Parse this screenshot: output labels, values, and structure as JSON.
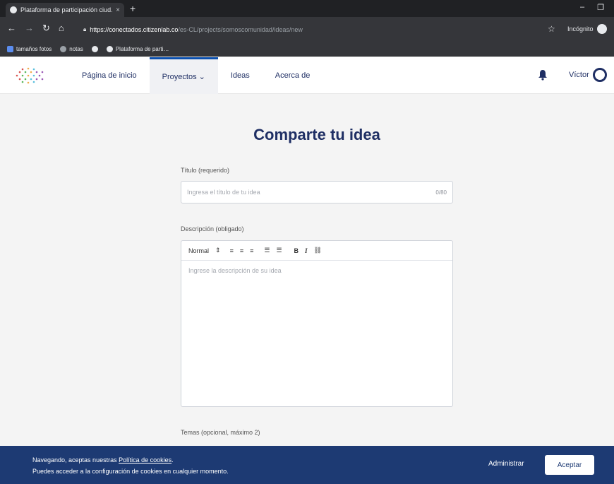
{
  "browser": {
    "tab_title": "Plataforma de participación ciud…",
    "tab_close": "×",
    "new_tab": "+",
    "url_host": "https://conectados.citizenlab.co",
    "url_path": "/es-CL/projects/somoscomunidad/ideas/new",
    "incognito_label": "Incógnito",
    "bookmarks": [
      {
        "label": "tamaños fotos"
      },
      {
        "label": "notas"
      },
      {
        "label": ""
      },
      {
        "label": "Plataforma de parti…"
      }
    ]
  },
  "nav": {
    "items": [
      {
        "label": "Página de inicio"
      },
      {
        "label": "Proyectos ⌄"
      },
      {
        "label": "Ideas"
      },
      {
        "label": "Acerca de"
      }
    ],
    "active_index": 1,
    "user_name": "Víctor"
  },
  "form": {
    "heading": "Comparte tu idea",
    "title_label": "Título (requerido)",
    "title_placeholder": "Ingresa el título de tu idea",
    "title_counter": "0/80",
    "description_label": "Descripción (obligado)",
    "toolbar_format": "Normal",
    "toolbar_format_arrow": "⇕",
    "toolbar_align": [
      "≡",
      "≡",
      "≡"
    ],
    "toolbar_lists": [
      "☰",
      "☰"
    ],
    "toolbar_bold": "B",
    "toolbar_italic": "I",
    "toolbar_link": "⛓",
    "description_placeholder": "Ingrese la descripción de su idea",
    "topics_label": "Temas (opcional, máximo 2)"
  },
  "cookie": {
    "line1_prefix": "Navegando, aceptas nuestras ",
    "policy_link": "Política de cookies",
    "line1_suffix": ".",
    "line2": "Puedes acceder a la configuración de cookies en cualquier momento.",
    "manage_label": "Administrar",
    "accept_label": "Aceptar"
  },
  "colors": {
    "brand_navy": "#1f2f64",
    "active_tab_accent": "#0b4fad",
    "cookie_banner": "#1d3a73"
  }
}
